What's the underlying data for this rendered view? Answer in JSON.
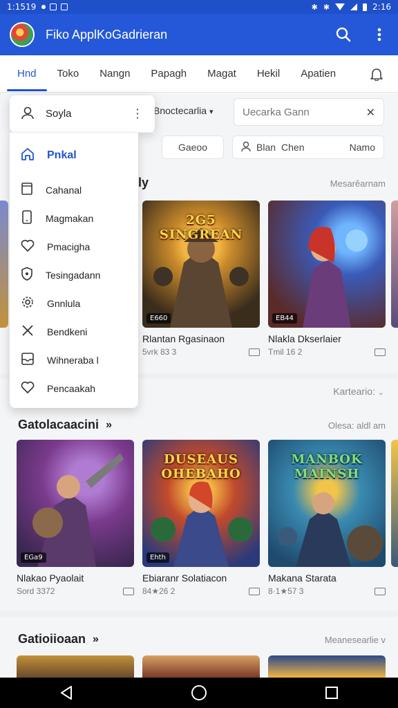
{
  "status_bar": {
    "time": "1:1519",
    "right_time": "2:16"
  },
  "app_bar": {
    "title": "Fiko ApplKoGadrieran"
  },
  "tabs": [
    {
      "label": "Hnd",
      "active": true
    },
    {
      "label": "Toko"
    },
    {
      "label": "Nangn"
    },
    {
      "label": "Papagh"
    },
    {
      "label": "Magat"
    },
    {
      "label": "Hekil"
    },
    {
      "label": "Apatien"
    }
  ],
  "filter": {
    "dropdown_label": "Bnoctecarlia",
    "search_placeholder": "Uecarka Gann"
  },
  "chips": {
    "chip1": "Gaeoo",
    "chip2_label": "Blan",
    "chip2_mid": "Chen",
    "chip2_sub": "Namo"
  },
  "menu": {
    "top_label": "Soyla",
    "items": [
      {
        "label": "Pnkal",
        "icon": "house-icon"
      },
      {
        "label": "Cahanal",
        "icon": "square-icon"
      },
      {
        "label": "Magmakan",
        "icon": "phone-icon"
      },
      {
        "label": "Pmacigha",
        "icon": "heart-icon"
      },
      {
        "label": "Tesingadann",
        "icon": "shield-icon"
      },
      {
        "label": "Gnnlula",
        "icon": "gear-icon"
      },
      {
        "label": "Bendkeni",
        "icon": "tools-icon"
      },
      {
        "label": "Wihneraba l",
        "icon": "inbox-icon"
      },
      {
        "label": "Pencaakah",
        "icon": "heart-icon"
      }
    ]
  },
  "section1": {
    "title": "ly",
    "more": "Mesarêarnam",
    "cards": [
      {
        "title": "Rlantan Rgasinaon",
        "meta": "5vrk 83 3",
        "badge": "E660",
        "art_text": "2G5 SINGREAN",
        "colors": [
          "#3b2d1c",
          "#c98a2b",
          "#f2b544"
        ]
      },
      {
        "title": "Nlakla Dkserlaier",
        "meta": "Tmil 16 2",
        "badge": "EB44",
        "art_text": "",
        "colors": [
          "#5b2a2a",
          "#b4472e",
          "#3a5bb8"
        ]
      }
    ]
  },
  "sort": {
    "label": "Karteario:"
  },
  "section2": {
    "title": "Gatolacaacini",
    "more": "Olesa: aldl am",
    "cards": [
      {
        "title": "Nlakao Pyaolait",
        "meta": "Sord 3372",
        "badge": "EGa9",
        "art_text": "",
        "colors": [
          "#3a2750",
          "#7a3a8c",
          "#b07bd2"
        ]
      },
      {
        "title": "Ebiaranr Solatiacon",
        "meta": "84★26 2",
        "badge": "Ehth",
        "art_text": "DUSEAUS OHEBAHO",
        "colors": [
          "#2a3a7a",
          "#c24a2c",
          "#f2b544"
        ]
      },
      {
        "title": "Makana Starata",
        "meta": "8·1★57 3",
        "badge": "",
        "art_text": "MANBOK MAINSH",
        "colors": [
          "#1e4a6e",
          "#3a8ab0",
          "#f2c54a"
        ]
      }
    ]
  },
  "section3": {
    "title": "Gatioiioaan",
    "more": "Meanesearlie v"
  },
  "nav": [
    "back",
    "home",
    "recents"
  ]
}
